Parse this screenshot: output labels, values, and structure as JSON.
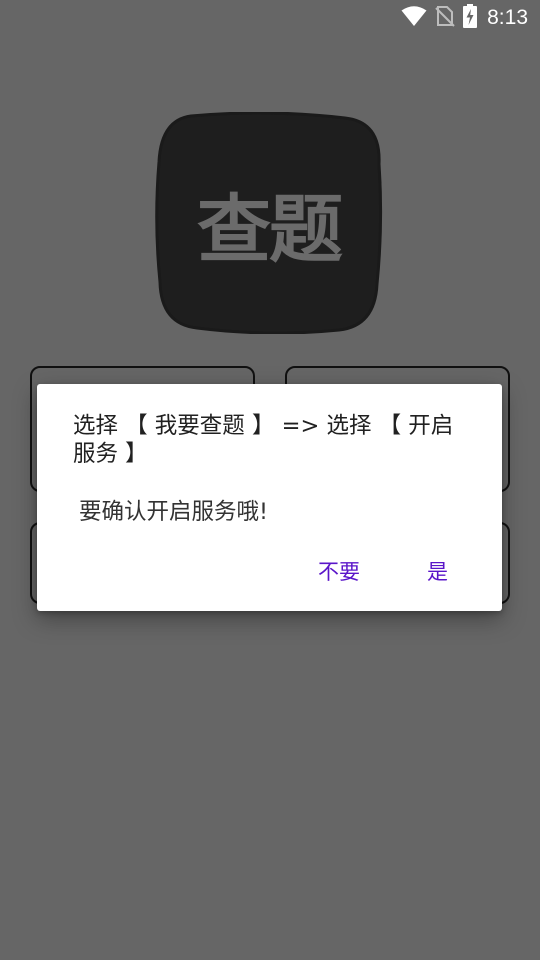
{
  "status_bar": {
    "time": "8:13",
    "icons": [
      "wifi-icon",
      "no-sim-icon",
      "battery-charging-icon"
    ]
  },
  "app": {
    "logo_text": "查题"
  },
  "dialog": {
    "title": "选择 【 我要查题 】 => 选择 【 开启服务 】",
    "message": "要确认开启服务哦!",
    "cancel_label": "不要",
    "ok_label": "是"
  },
  "colors": {
    "background": "#666666",
    "logo": "#1e1e1e",
    "accent": "#5a15c9"
  }
}
